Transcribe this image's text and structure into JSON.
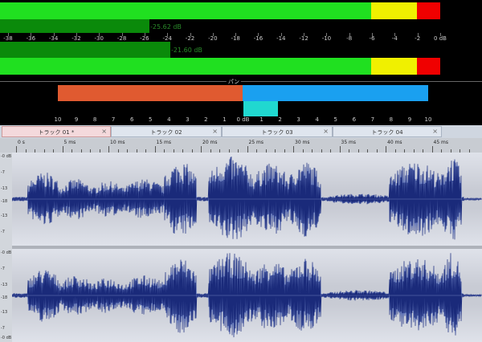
{
  "meters": {
    "scale_labels": [
      "-38",
      "-36",
      "-34",
      "-32",
      "-30",
      "-28",
      "-26",
      "-24",
      "-22",
      "-20",
      "-18",
      "-16",
      "-14",
      "-12",
      "-10",
      "-8",
      "-6",
      "-4",
      "-2",
      "0 dB"
    ],
    "scale_values": [
      -38,
      -36,
      -34,
      -32,
      -30,
      -28,
      -26,
      -24,
      -22,
      -20,
      -18,
      -16,
      -14,
      -12,
      -10,
      -8,
      -6,
      -4,
      -2,
      0
    ],
    "left_value": "-25.62 dB",
    "right_value": "-21.60 dB",
    "left_level_db": -25.62,
    "right_level_db": -21.6,
    "colors": {
      "green": "#20e020",
      "dark_green": "#0a8a0a",
      "yellow": "#f0f000",
      "red": "#f00000"
    }
  },
  "pan": {
    "title": "パン",
    "scale_labels": [
      "10",
      "9",
      "8",
      "7",
      "6",
      "5",
      "4",
      "3",
      "2",
      "1",
      "0 dB",
      "1",
      "2",
      "3",
      "4",
      "5",
      "6",
      "7",
      "8",
      "9",
      "10"
    ],
    "left_fraction": 0.43,
    "right_fraction": 0.5,
    "colors": {
      "left": "#e05a30",
      "right": "#1aa0f0",
      "center": "#20d8d0"
    }
  },
  "tabs": [
    {
      "label": "トラック 01 *",
      "close": "×",
      "active": true
    },
    {
      "label": "トラック 02",
      "close": "×",
      "active": false
    },
    {
      "label": "トラック 03",
      "close": "×",
      "active": false
    },
    {
      "label": "トラック 04",
      "close": "×",
      "active": false
    }
  ],
  "ruler": {
    "labels": [
      "0 s",
      "5 ms",
      "10 ms",
      "15 ms",
      "20 ms",
      "25 ms",
      "30 ms",
      "35 ms",
      "40 ms",
      "45 ms"
    ]
  },
  "vscale_top": [
    "-0 dB",
    "-7",
    "-13",
    "-18",
    "-13",
    "-7"
  ],
  "vscale_bottom": [
    "-0 dB",
    "-7",
    "-13",
    "-18",
    "-13",
    "-7",
    "-0 dB"
  ],
  "wave_color": "#1a2a7a"
}
